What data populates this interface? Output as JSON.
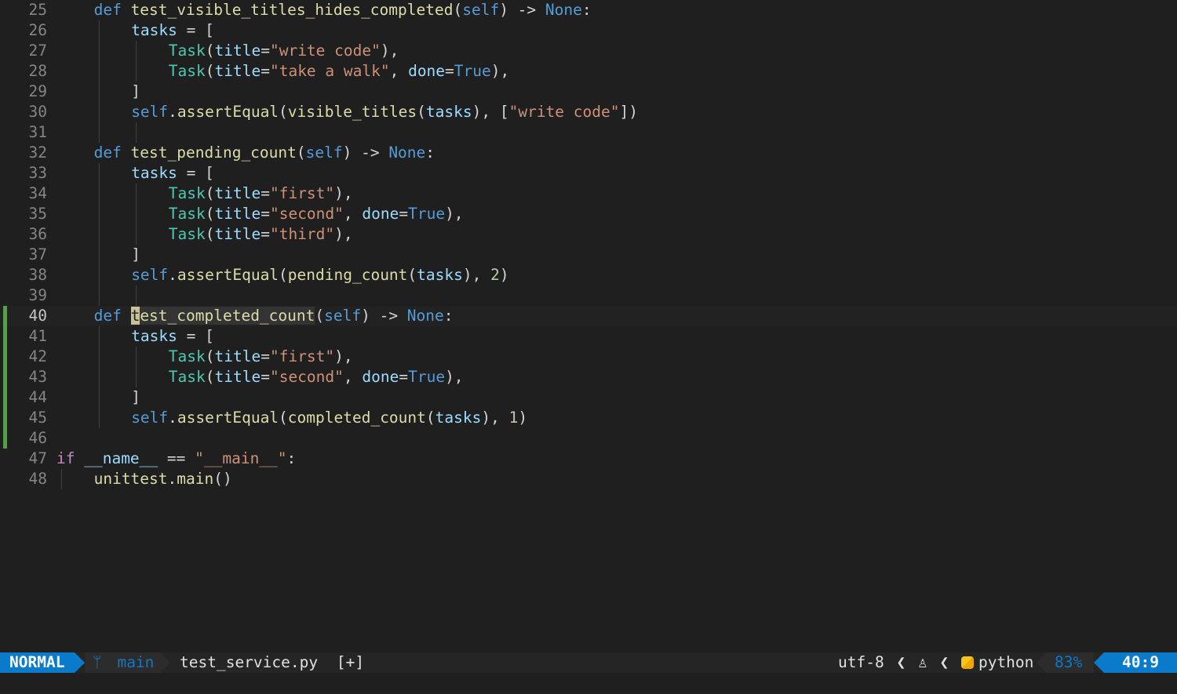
{
  "editor": {
    "lines": [
      {
        "n": "25",
        "i": 1,
        "t": [
          [
            "kw",
            "def "
          ],
          [
            "fn",
            "test_visible_titles_hides_completed"
          ],
          [
            "pn",
            "("
          ],
          [
            "self",
            "self"
          ],
          [
            "pn",
            ") -> "
          ],
          [
            "kw",
            "None"
          ],
          [
            "pn",
            ":"
          ]
        ]
      },
      {
        "n": "26",
        "i": 2,
        "t": [
          [
            "var",
            "tasks"
          ],
          [
            "pn",
            " = ["
          ]
        ]
      },
      {
        "n": "27",
        "i": 3,
        "t": [
          [
            "cls",
            "Task"
          ],
          [
            "pn",
            "("
          ],
          [
            "var",
            "title"
          ],
          [
            "pn",
            "="
          ],
          [
            "str",
            "\"write code\""
          ],
          [
            "pn",
            "),"
          ]
        ]
      },
      {
        "n": "28",
        "i": 3,
        "t": [
          [
            "cls",
            "Task"
          ],
          [
            "pn",
            "("
          ],
          [
            "var",
            "title"
          ],
          [
            "pn",
            "="
          ],
          [
            "str",
            "\"take a walk\""
          ],
          [
            "pn",
            ", "
          ],
          [
            "var",
            "done"
          ],
          [
            "pn",
            "="
          ],
          [
            "kw",
            "True"
          ],
          [
            "pn",
            "),"
          ]
        ]
      },
      {
        "n": "29",
        "i": 2,
        "t": [
          [
            "pn",
            "]"
          ]
        ]
      },
      {
        "n": "30",
        "i": 2,
        "t": [
          [
            "self",
            "self"
          ],
          [
            "pn",
            "."
          ],
          [
            "fn",
            "assertEqual"
          ],
          [
            "pn",
            "("
          ],
          [
            "fn",
            "visible_titles"
          ],
          [
            "pn",
            "("
          ],
          [
            "var",
            "tasks"
          ],
          [
            "pn",
            "), ["
          ],
          [
            "str",
            "\"write code\""
          ],
          [
            "pn",
            "])"
          ]
        ]
      },
      {
        "n": "31",
        "i": 2,
        "t": []
      },
      {
        "n": "32",
        "i": 1,
        "t": [
          [
            "kw",
            "def "
          ],
          [
            "fn",
            "test_pending_count"
          ],
          [
            "pn",
            "("
          ],
          [
            "self",
            "self"
          ],
          [
            "pn",
            ") -> "
          ],
          [
            "kw",
            "None"
          ],
          [
            "pn",
            ":"
          ]
        ]
      },
      {
        "n": "33",
        "i": 2,
        "t": [
          [
            "var",
            "tasks"
          ],
          [
            "pn",
            " = ["
          ]
        ]
      },
      {
        "n": "34",
        "i": 3,
        "t": [
          [
            "cls",
            "Task"
          ],
          [
            "pn",
            "("
          ],
          [
            "var",
            "title"
          ],
          [
            "pn",
            "="
          ],
          [
            "str",
            "\"first\""
          ],
          [
            "pn",
            "),"
          ]
        ]
      },
      {
        "n": "35",
        "i": 3,
        "t": [
          [
            "cls",
            "Task"
          ],
          [
            "pn",
            "("
          ],
          [
            "var",
            "title"
          ],
          [
            "pn",
            "="
          ],
          [
            "str",
            "\"second\""
          ],
          [
            "pn",
            ", "
          ],
          [
            "var",
            "done"
          ],
          [
            "pn",
            "="
          ],
          [
            "kw",
            "True"
          ],
          [
            "pn",
            "),"
          ]
        ]
      },
      {
        "n": "36",
        "i": 3,
        "t": [
          [
            "cls",
            "Task"
          ],
          [
            "pn",
            "("
          ],
          [
            "var",
            "title"
          ],
          [
            "pn",
            "="
          ],
          [
            "str",
            "\"third\""
          ],
          [
            "pn",
            "),"
          ]
        ]
      },
      {
        "n": "37",
        "i": 2,
        "t": [
          [
            "pn",
            "]"
          ]
        ]
      },
      {
        "n": "38",
        "i": 2,
        "t": [
          [
            "self",
            "self"
          ],
          [
            "pn",
            "."
          ],
          [
            "fn",
            "assertEqual"
          ],
          [
            "pn",
            "("
          ],
          [
            "fn",
            "pending_count"
          ],
          [
            "pn",
            "("
          ],
          [
            "var",
            "tasks"
          ],
          [
            "pn",
            "), "
          ],
          [
            "num",
            "2"
          ],
          [
            "pn",
            ")"
          ]
        ]
      },
      {
        "n": "39",
        "i": 2,
        "t": []
      },
      {
        "n": "40",
        "i": 1,
        "current": true,
        "t": [
          [
            "kw",
            "def "
          ],
          [
            "cursor",
            "t"
          ],
          [
            "fnhl",
            "est_completed_count"
          ],
          [
            "pn",
            "("
          ],
          [
            "self",
            "self"
          ],
          [
            "pn",
            ") -> "
          ],
          [
            "kw",
            "None"
          ],
          [
            "pn",
            ":"
          ]
        ]
      },
      {
        "n": "41",
        "i": 2,
        "t": [
          [
            "var",
            "tasks"
          ],
          [
            "pn",
            " = ["
          ]
        ]
      },
      {
        "n": "42",
        "i": 3,
        "t": [
          [
            "cls",
            "Task"
          ],
          [
            "pn",
            "("
          ],
          [
            "var",
            "title"
          ],
          [
            "pn",
            "="
          ],
          [
            "str",
            "\"first\""
          ],
          [
            "pn",
            "),"
          ]
        ]
      },
      {
        "n": "43",
        "i": 3,
        "t": [
          [
            "cls",
            "Task"
          ],
          [
            "pn",
            "("
          ],
          [
            "var",
            "title"
          ],
          [
            "pn",
            "="
          ],
          [
            "str",
            "\"second\""
          ],
          [
            "pn",
            ", "
          ],
          [
            "var",
            "done"
          ],
          [
            "pn",
            "="
          ],
          [
            "kw",
            "True"
          ],
          [
            "pn",
            "),"
          ]
        ]
      },
      {
        "n": "44",
        "i": 2,
        "t": [
          [
            "pn",
            "]"
          ]
        ]
      },
      {
        "n": "45",
        "i": 2,
        "t": [
          [
            "self",
            "self"
          ],
          [
            "pn",
            "."
          ],
          [
            "fn",
            "assertEqual"
          ],
          [
            "pn",
            "("
          ],
          [
            "fn",
            "completed_count"
          ],
          [
            "pn",
            "("
          ],
          [
            "var",
            "tasks"
          ],
          [
            "pn",
            "), "
          ],
          [
            "num",
            "1"
          ],
          [
            "pn",
            ")"
          ]
        ]
      },
      {
        "n": "46",
        "i": 0,
        "t": []
      },
      {
        "n": "47",
        "i": 0,
        "t": [
          [
            "kw2",
            "if "
          ],
          [
            "var",
            "__name__"
          ],
          [
            "pn",
            " == "
          ],
          [
            "str",
            "\"__main__\""
          ],
          [
            "pn",
            ":"
          ]
        ]
      },
      {
        "n": "48",
        "i": 1,
        "t": [
          [
            "fn",
            "unittest"
          ],
          [
            "pn",
            "."
          ],
          [
            "fn",
            "main"
          ],
          [
            "pn",
            "()"
          ]
        ]
      }
    ],
    "git_changed_lines": [
      "40",
      "41",
      "42",
      "43",
      "44",
      "45",
      "46"
    ]
  },
  "statusline": {
    "mode": "NORMAL",
    "branch_icon": "git-branch-icon",
    "branch": "main",
    "filename": "test_service.py",
    "modified": "[+]",
    "encoding": "utf-8",
    "os_icon": "linux-icon",
    "filetype_icon": "python-icon",
    "filetype": "python",
    "percent": "83%",
    "position": "40:9"
  },
  "colors": {
    "accent": "#0a7aca",
    "background": "#1f1f1f",
    "git_added": "#5c9a4f"
  }
}
